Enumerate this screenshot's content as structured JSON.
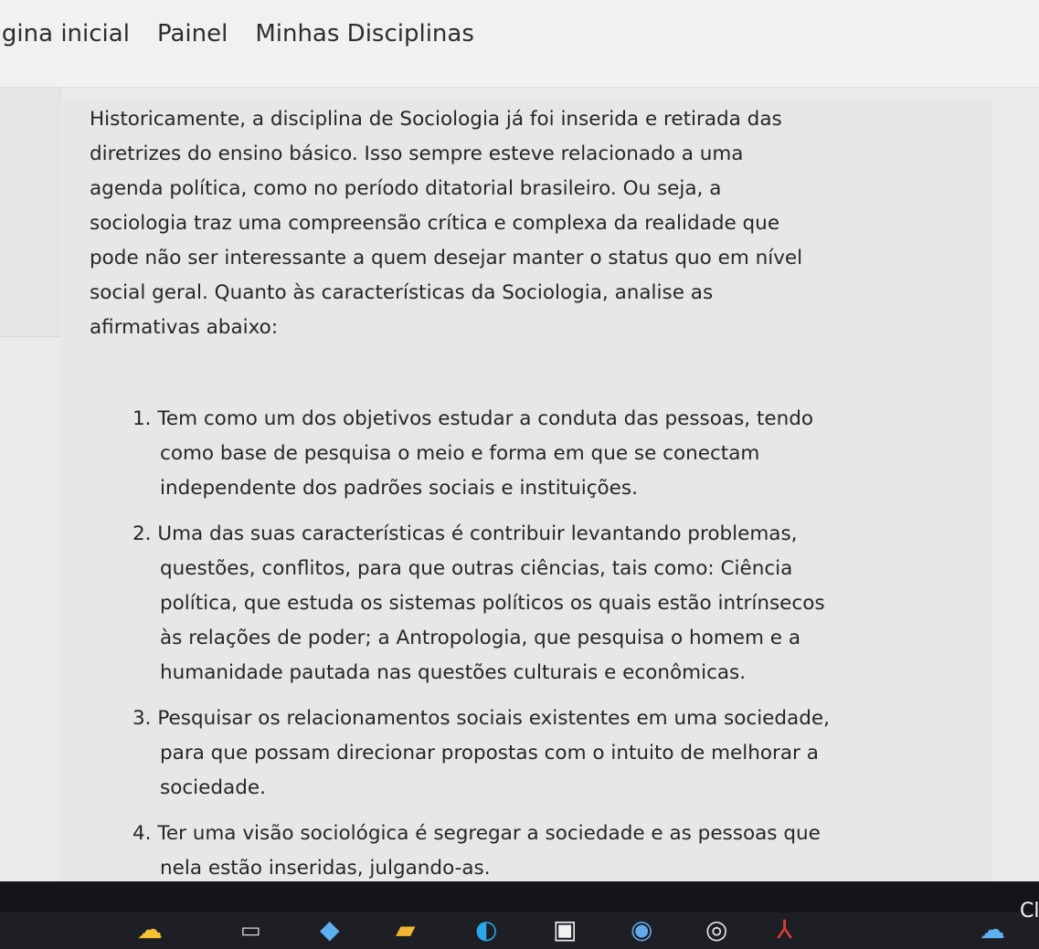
{
  "nav": {
    "home": "ágina inicial",
    "dashboard": "Painel",
    "courses": "Minhas Disciplinas"
  },
  "question": {
    "intro_lines": [
      "Historicamente, a disciplina de Sociologia já foi inserida e retirada das",
      "diretrizes do  ensino básico. Isso sempre esteve relacionado a uma",
      "agenda política, como no período ditatorial brasileiro. Ou seja,  a",
      "sociologia traz uma compreensão crítica e complexa da realidade que",
      "pode não ser interessante a quem desejar manter o status quo em nível",
      "social geral.  Quanto às características da Sociologia, analise as",
      "afirmativas abaixo:"
    ],
    "items": [
      {
        "num": "1.",
        "lines": [
          "Tem como um dos objetivos estudar a conduta das pessoas, tendo",
          "como base de pesquisa o meio e forma em que se conectam",
          "independente dos padrões sociais e instituições."
        ]
      },
      {
        "num": "2.",
        "lines": [
          "Uma das suas características é contribuir levantando problemas,",
          "questões, conflitos, para que outras ciências, tais como: Ciência",
          "política, que estuda os sistemas políticos os quais estão intrínsecos",
          "às relações de poder; a Antropologia, que pesquisa o homem e a",
          "humanidade pautada nas questões culturais e econômicas."
        ]
      },
      {
        "num": "3.",
        "lines": [
          "Pesquisar os relacionamentos sociais existentes em uma sociedade,",
          "para que possam direcionar propostas com o intuito de melhorar a",
          "sociedade."
        ]
      },
      {
        "num": "4.",
        "lines": [
          "Ter uma visão sociológica é segregar a sociedade e as pessoas que",
          "nela estão inseridas, julgando-as."
        ]
      }
    ]
  },
  "taskbar": {
    "icons": [
      "weather-icon",
      "task-view-icon",
      "copilot-icon",
      "file-explorer-icon",
      "edge-icon",
      "store-icon",
      "app-icon",
      "chrome-icon",
      "acrobat-icon",
      "tray-weather-icon"
    ],
    "clock_partial": "Cl"
  }
}
